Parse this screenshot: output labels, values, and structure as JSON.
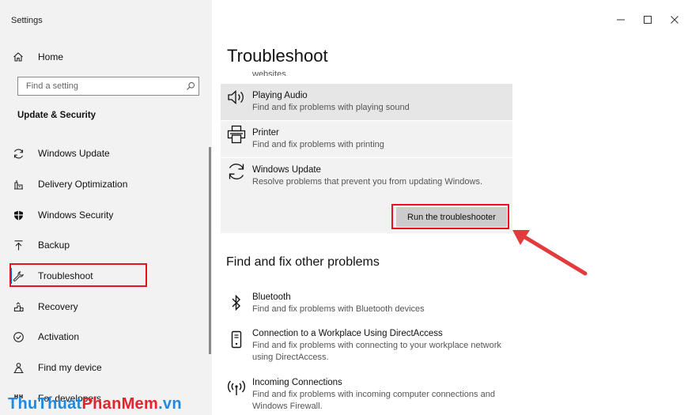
{
  "window": {
    "title": "Settings",
    "minimize": "–",
    "maximize": "☐",
    "close": "✕"
  },
  "sidebar": {
    "home_label": "Home",
    "search_placeholder": "Find a setting",
    "section_title": "Update & Security",
    "items": [
      {
        "label": "Windows Update",
        "icon": "sync-icon"
      },
      {
        "label": "Delivery Optimization",
        "icon": "delivery-icon"
      },
      {
        "label": "Windows Security",
        "icon": "shield-icon"
      },
      {
        "label": "Backup",
        "icon": "backup-icon"
      },
      {
        "label": "Troubleshoot",
        "icon": "wrench-icon"
      },
      {
        "label": "Recovery",
        "icon": "recovery-icon"
      },
      {
        "label": "Activation",
        "icon": "activation-icon"
      },
      {
        "label": "Find my device",
        "icon": "person-icon"
      },
      {
        "label": "For developers",
        "icon": "developers-icon"
      }
    ],
    "selected": "Troubleshoot"
  },
  "main": {
    "title": "Troubleshoot",
    "prev_tail": "websites.",
    "cards": [
      {
        "title": "Playing Audio",
        "desc": "Find and fix problems with playing sound",
        "icon": "speaker-icon"
      },
      {
        "title": "Printer",
        "desc": "Find and fix problems with printing",
        "icon": "printer-icon"
      },
      {
        "title": "Windows Update",
        "desc": "Resolve problems that prevent you from updating Windows.",
        "icon": "sync-icon"
      }
    ],
    "run_button": "Run the troubleshooter",
    "other_heading": "Find and fix other problems",
    "other_items": [
      {
        "title": "Bluetooth",
        "desc": "Find and fix problems with Bluetooth devices",
        "icon": "bluetooth-icon"
      },
      {
        "title": "Connection to a Workplace Using DirectAccess",
        "desc": "Find and fix problems with connecting to your workplace network using DirectAccess.",
        "icon": "device-icon"
      },
      {
        "title": "Incoming Connections",
        "desc": "Find and fix problems with incoming computer connections and Windows Firewall.",
        "icon": "antenna-icon"
      }
    ]
  },
  "watermark": {
    "part1": "ThuThuat",
    "part2": "PhanMem",
    "part3": ".vn"
  },
  "colors": {
    "highlight": "#e81123",
    "accent": "#0067c0",
    "sidebar_bg": "#f2f2f2"
  }
}
